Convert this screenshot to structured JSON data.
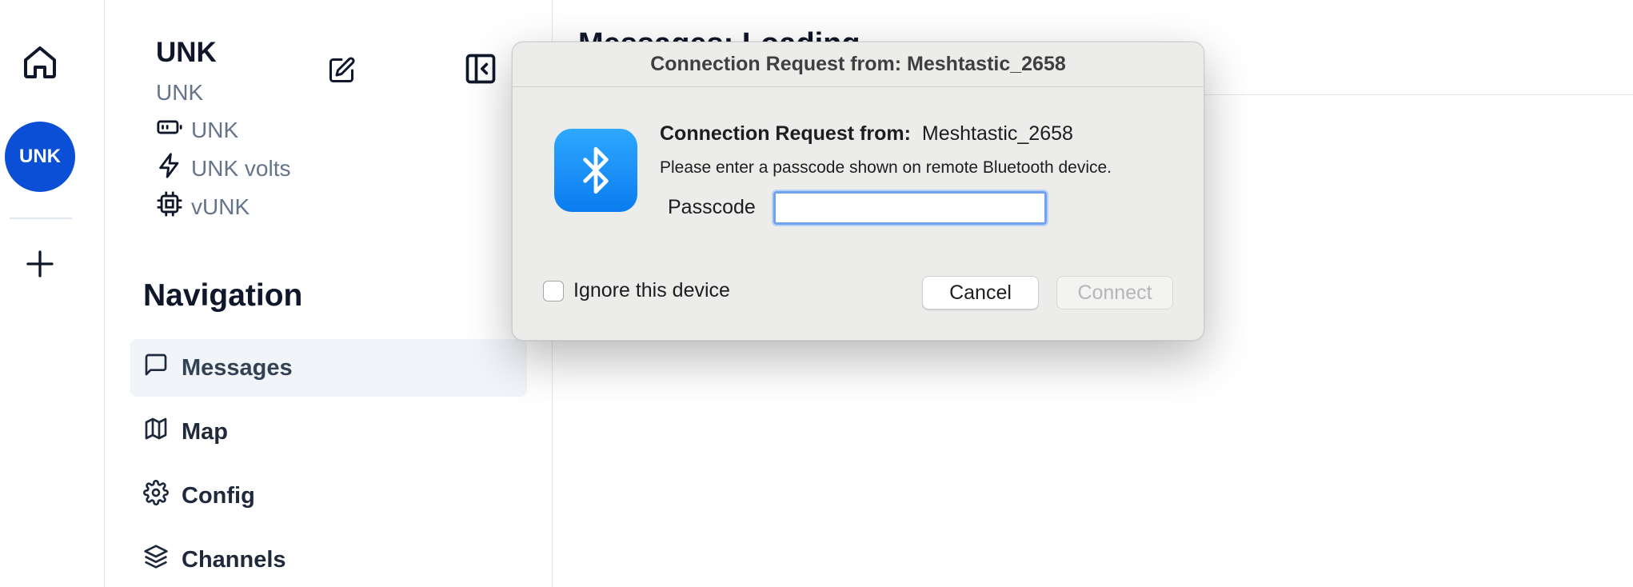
{
  "rail": {
    "avatar_text": "UNK"
  },
  "device": {
    "name": "UNK",
    "short_name": "UNK",
    "battery": "UNK",
    "voltage": "UNK volts",
    "firmware": "vUNK"
  },
  "navigation": {
    "title": "Navigation",
    "items": [
      {
        "label": "Messages",
        "icon": "message-square-icon",
        "active": true
      },
      {
        "label": "Map",
        "icon": "map-icon",
        "active": false
      },
      {
        "label": "Config",
        "icon": "gear-icon",
        "active": false
      },
      {
        "label": "Channels",
        "icon": "layers-icon",
        "active": false
      }
    ]
  },
  "main": {
    "title": "Messages: Loading"
  },
  "dialog": {
    "window_title": "Connection Request from: Meshtastic_2658",
    "heading_label": "Connection Request from:",
    "heading_value": "Meshtastic_2658",
    "message": "Please enter a passcode shown on remote Bluetooth device.",
    "passcode_label": "Passcode",
    "passcode_value": "",
    "ignore_label": "Ignore this device",
    "ignore_checked": false,
    "cancel_label": "Cancel",
    "connect_label": "Connect"
  },
  "colors": {
    "avatar": "#0b4fd6",
    "bluetooth": "#0a7cf0",
    "focus_ring": "#6fa2f3"
  }
}
